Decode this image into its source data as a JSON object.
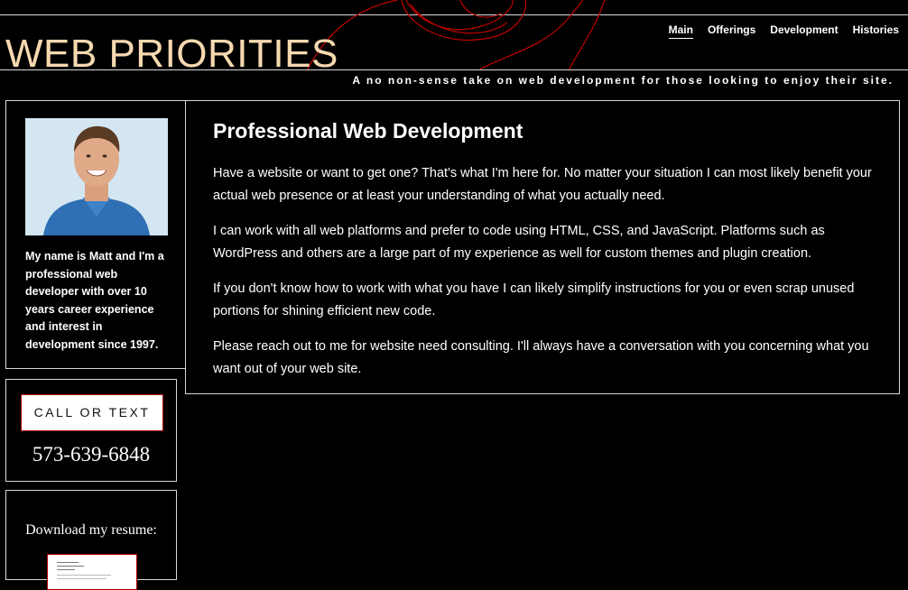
{
  "header": {
    "site_title": "WEB PRIORITIES",
    "tagline": "A no non-sense take on web development for those looking to enjoy their site.",
    "nav": [
      {
        "label": "Main",
        "active": true
      },
      {
        "label": "Offerings",
        "active": false
      },
      {
        "label": "Development",
        "active": false
      },
      {
        "label": "Histories",
        "active": false
      }
    ]
  },
  "sidebar": {
    "profile": {
      "bio": "My name is Matt and I'm a professional web developer with over 10 years career experience and interest in development since 1997."
    },
    "contact": {
      "button_label": "CALL OR TEXT",
      "phone": "573-639-6848"
    },
    "resume": {
      "label": "Download my resume:"
    }
  },
  "main": {
    "title": "Professional Web Development",
    "paragraphs": [
      "Have a website or want to get one? That's what I'm here for. No matter your situation I can most likely benefit your actual web presence or at least your understanding of what you actually need.",
      "I can work with all web platforms and prefer to code using HTML, CSS, and JavaScript. Platforms such as WordPress and others are a large part of my experience as well for custom themes and plugin creation.",
      "If you don't know how to work with what you have I can likely simplify instructions for you or even scrap unused portions for shining efficient new code.",
      "Please reach out to me for website need consulting. I'll always have a conversation with you concerning what you want out of your web site."
    ]
  },
  "colors": {
    "background": "#000000",
    "title_accent": "#f6d9b0",
    "border": "#d8d8d8",
    "button_border": "#b30000",
    "swirl": "#c00000"
  }
}
